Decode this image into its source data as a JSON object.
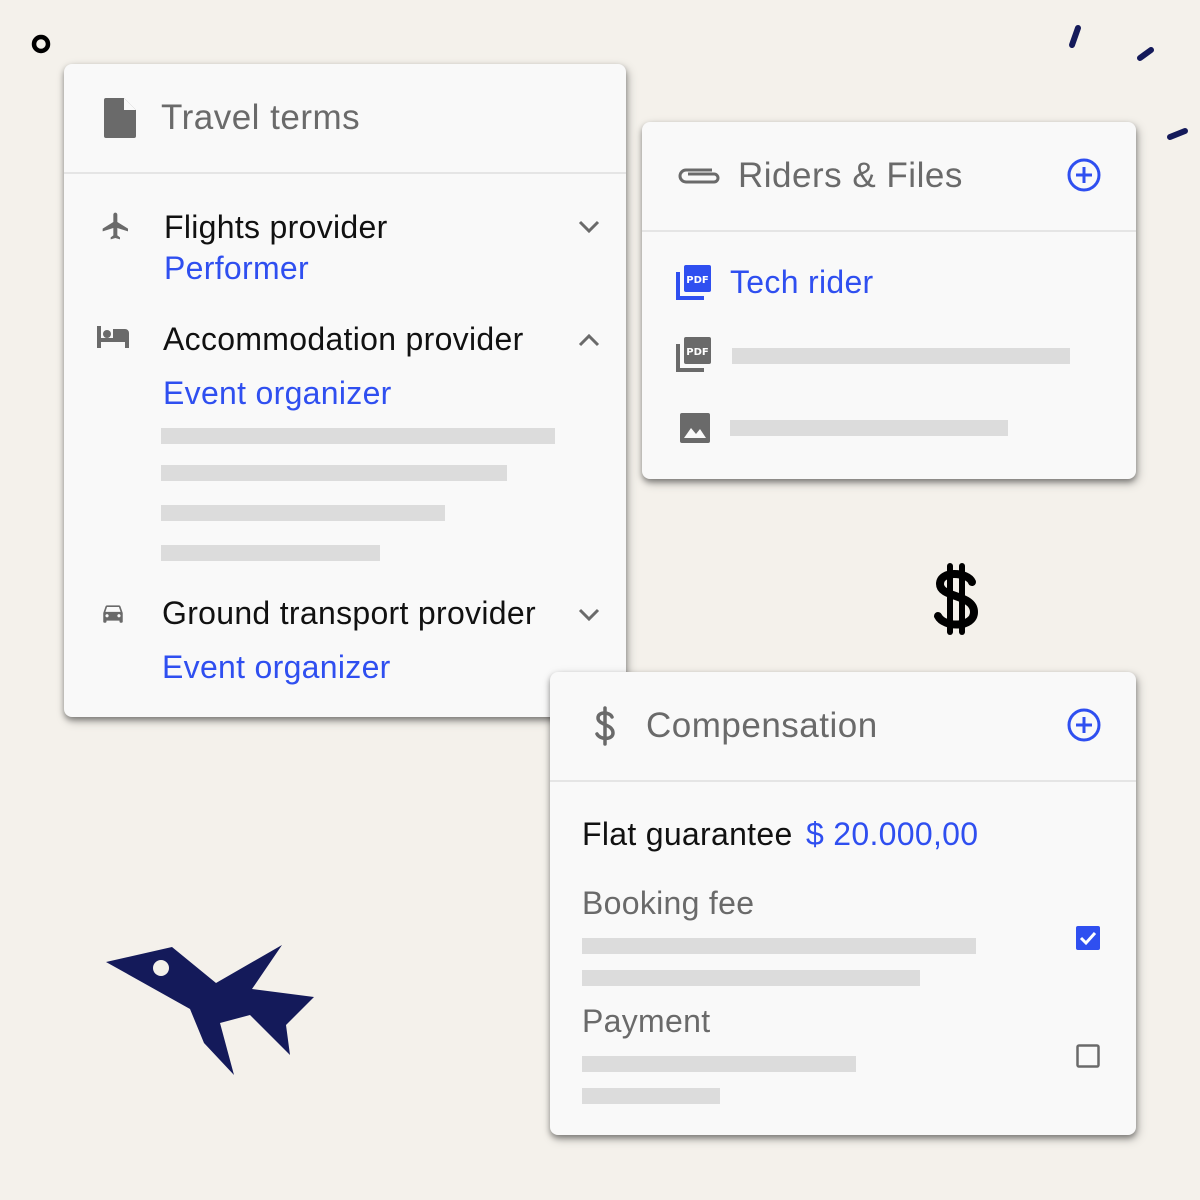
{
  "travel_terms": {
    "title": "Travel terms",
    "icon": "document-icon",
    "items": [
      {
        "label": "Flights provider",
        "value": "Performer",
        "icon": "airplane-icon",
        "expanded": false
      },
      {
        "label": "Accommodation provider",
        "value": "Event organizer",
        "icon": "bed-icon",
        "expanded": true
      },
      {
        "label": "Ground transport provider",
        "value": "Event organizer",
        "icon": "car-icon",
        "expanded": false
      }
    ]
  },
  "riders_files": {
    "title": "Riders & Files",
    "icon": "paperclip-icon",
    "add_icon": "add-circle-icon",
    "files": [
      {
        "name": "Tech rider",
        "icon": "pdf-icon"
      },
      {
        "name": "",
        "icon": "pdf-icon"
      },
      {
        "name": "",
        "icon": "image-icon"
      }
    ]
  },
  "compensation": {
    "title": "Compensation",
    "icon": "dollar-icon",
    "add_icon": "add-circle-icon",
    "flat_guarantee_label": "Flat guarantee",
    "flat_guarantee_value": "$ 20.000,00",
    "booking_fee_label": "Booking fee",
    "booking_fee_checked": true,
    "payment_label": "Payment",
    "payment_checked": false
  },
  "colors": {
    "accent": "#2f4ff0",
    "background": "#f4f1eb",
    "card": "#f9f9f9",
    "decor_navy": "#141a5a",
    "icon_gray": "#6a6a6a",
    "placeholder": "#dcdcdc"
  }
}
